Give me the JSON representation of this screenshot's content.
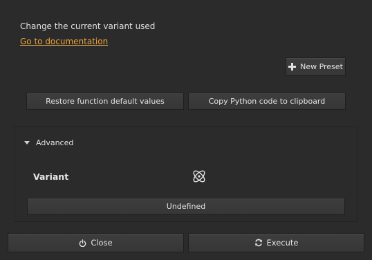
{
  "description": "Change the current variant used",
  "doc_link": "Go to documentation",
  "presets": {
    "new_preset_label": "New Preset",
    "new_preset_icon": "plus-icon"
  },
  "actions": {
    "restore_label": "Restore function default values",
    "copy_label": "Copy Python code to clipboard"
  },
  "advanced": {
    "header": "Advanced",
    "variant_label": "Variant",
    "variant_icon": "variant-icon",
    "variant_value": "Undefined"
  },
  "footer": {
    "close_label": "Close",
    "close_icon": "power-icon",
    "execute_label": "Execute",
    "execute_icon": "refresh-icon"
  },
  "colors": {
    "background": "#2b2b2b",
    "link": "#e6a23c",
    "button": "#3a3a3a"
  }
}
